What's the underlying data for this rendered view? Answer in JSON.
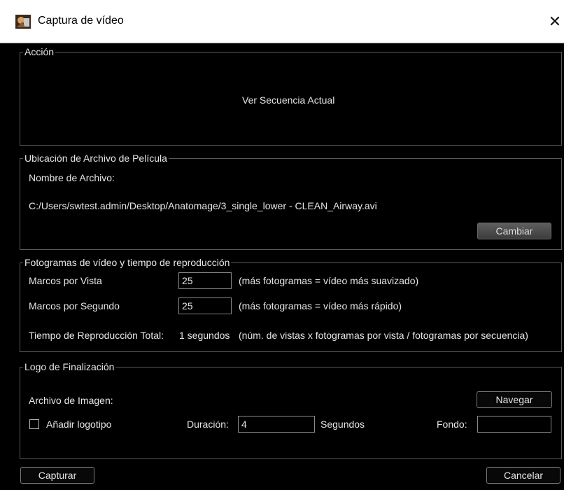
{
  "window": {
    "title": "Captura de vídeo",
    "close_glyph": "✕",
    "icon": "app-logo-icon"
  },
  "accion": {
    "title": "Acción",
    "value": "Ver Secuencia Actual"
  },
  "ubicacion": {
    "title": "Ubicación de Archivo de Película",
    "filename_label": "Nombre de Archivo:",
    "path": "C:/Users/swtest.admin/Desktop/Anatomage/3_single_lower - CLEAN_Airway.avi",
    "change_button": "Cambiar"
  },
  "fotogramas": {
    "title": "Fotogramas de vídeo y tiempo de reproducción",
    "frames_per_view_label": "Marcos por Vista",
    "frames_per_view_value": "25",
    "frames_per_view_hint": "(más fotogramas = vídeo más suavizado)",
    "frames_per_second_label": "Marcos por Segundo",
    "frames_per_second_value": "25",
    "frames_per_second_hint": "(más fotogramas = vídeo más rápido)",
    "total_time_label": "Tiempo de Reproducción Total:",
    "total_time_value": "1 segundos",
    "total_time_hint": "(núm. de vistas x fotogramas por vista / fotogramas por secuencia)"
  },
  "logo": {
    "title": "Logo de Finalización",
    "image_file_label": "Archivo de Imagen:",
    "browse_button": "Navegar",
    "add_logo_label": "Añadir logotipo",
    "add_logo_checked": false,
    "duration_label": "Duración:",
    "duration_value": "4",
    "seconds_label": "Segundos",
    "background_label": "Fondo:",
    "background_value": ""
  },
  "footer": {
    "capture_button": "Capturar",
    "cancel_button": "Cancelar"
  }
}
